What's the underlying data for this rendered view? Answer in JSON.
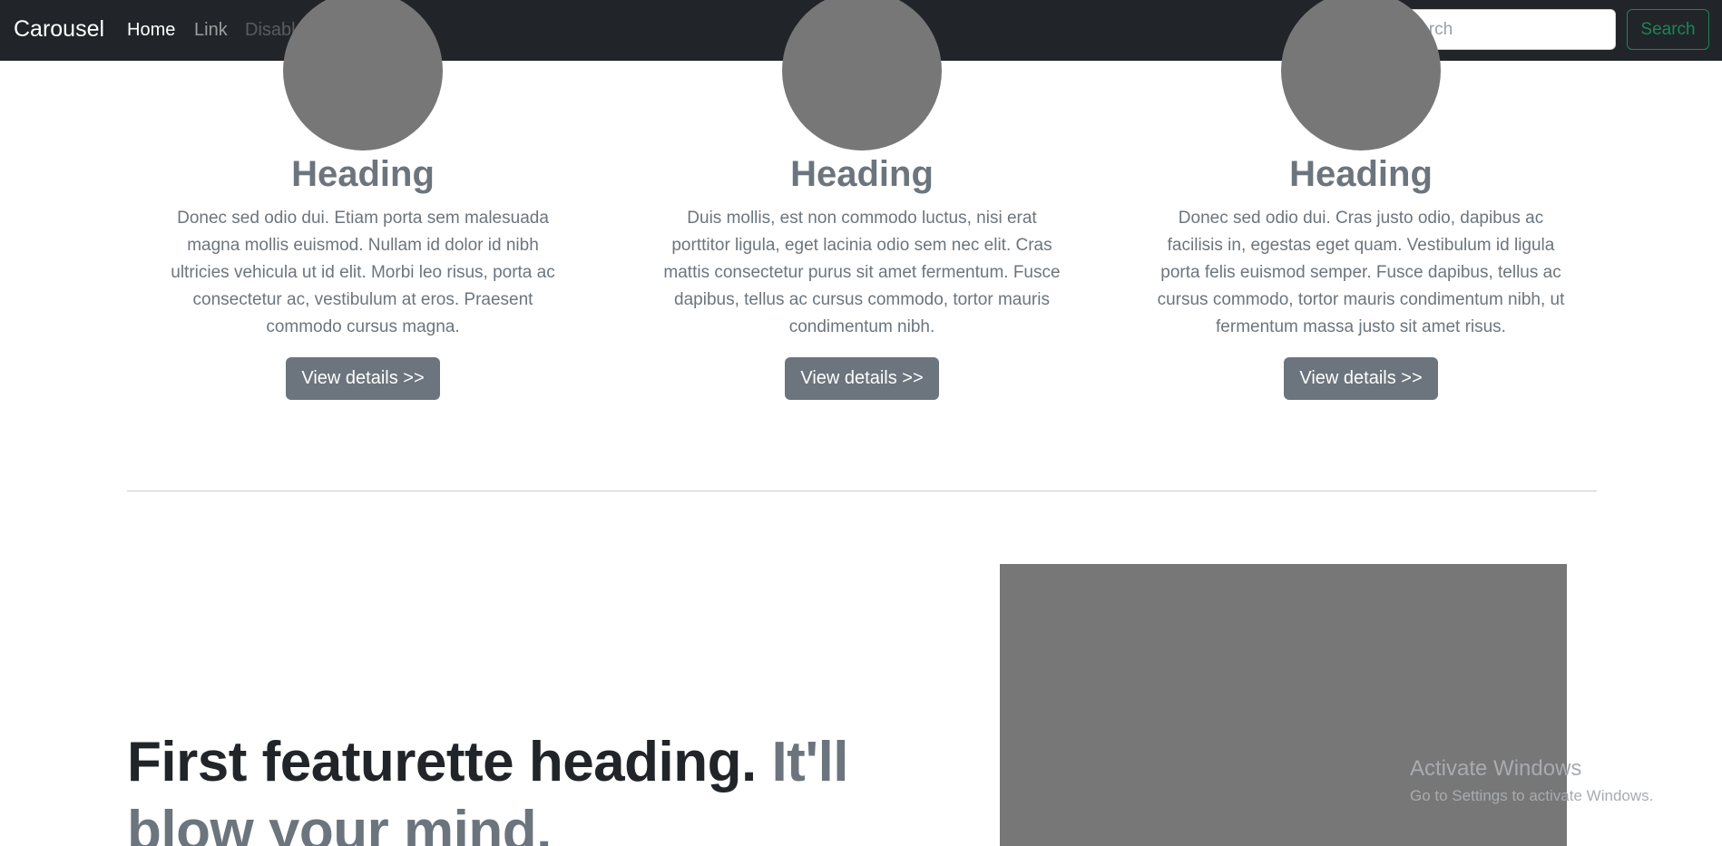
{
  "navbar": {
    "brand": "Carousel",
    "links": [
      "Home",
      "Link",
      "Disabled"
    ],
    "search_placeholder": "Search",
    "search_button": "Search"
  },
  "marketing": [
    {
      "heading": "Heading",
      "text": "Donec sed odio dui. Etiam porta sem malesuada magna mollis euismod. Nullam id dolor id nibh ultricies vehicula ut id elit. Morbi leo risus, porta ac consectetur ac, vestibulum at eros. Praesent commodo cursus magna.",
      "button": "View details >>"
    },
    {
      "heading": "Heading",
      "text": "Duis mollis, est non commodo luctus, nisi erat porttitor ligula, eget lacinia odio sem nec elit. Cras mattis consectetur purus sit amet fermentum. Fusce dapibus, tellus ac cursus commodo, tortor mauris condimentum nibh.",
      "button": "View details >>"
    },
    {
      "heading": "Heading",
      "text": "Donec sed odio dui. Cras justo odio, dapibus ac facilisis in, egestas eget quam. Vestibulum id ligula porta felis euismod semper. Fusce dapibus, tellus ac cursus commodo, tortor mauris condimentum nibh, ut fermentum massa justo sit amet risus.",
      "button": "View details >>"
    }
  ],
  "featurette": {
    "heading": "First featurette heading.",
    "muted": "It'll blow your mind."
  },
  "watermark": {
    "title": "Activate Windows",
    "subtitle": "Go to Settings to activate Windows."
  },
  "colors": {
    "navbar_bg": "#212529",
    "placeholder_gray": "#777777",
    "muted_text": "#6c757d",
    "success_outline": "#198754"
  }
}
